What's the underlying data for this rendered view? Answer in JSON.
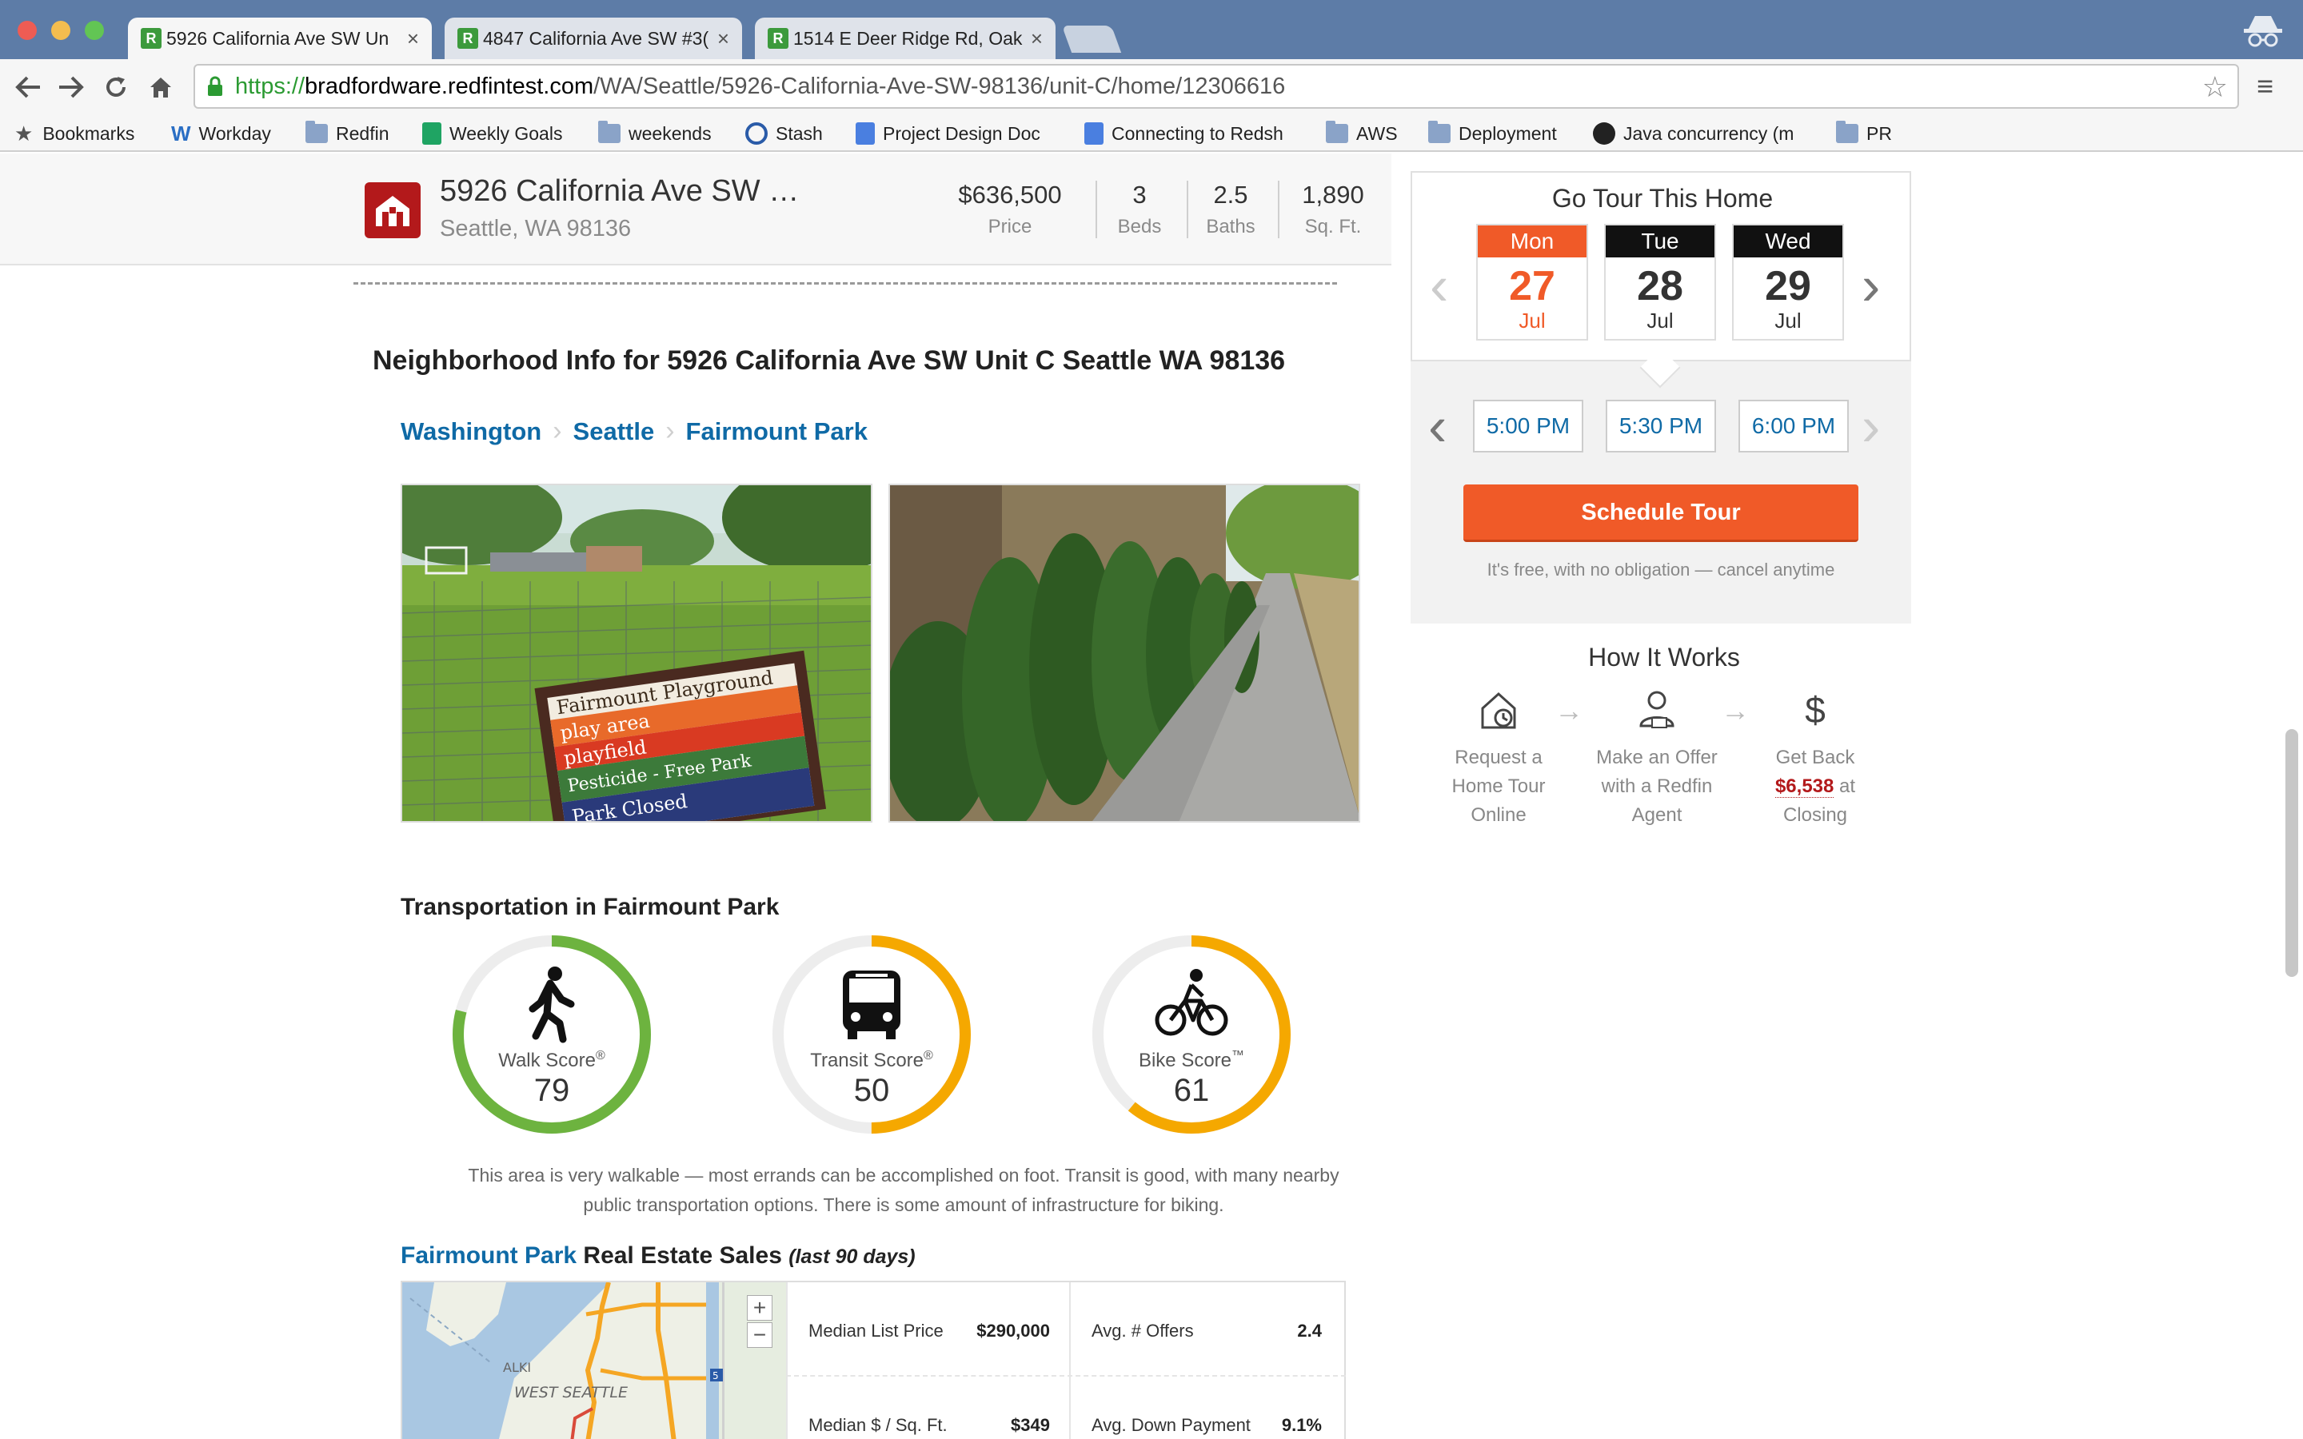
{
  "browser": {
    "tabs": [
      {
        "title": "5926 California Ave SW Un",
        "close": "×"
      },
      {
        "title": "4847 California Ave SW #3(",
        "close": "×"
      },
      {
        "title": "1514 E Deer Ridge Rd, Oak",
        "close": "×"
      }
    ],
    "favicon_letter": "R",
    "url": {
      "scheme": "https://",
      "host": "bradfordware.redfintest.com",
      "path": "/WA/Seattle/5926-California-Ave-SW-98136/unit-C/home/12306616"
    },
    "bookmarks": [
      {
        "label": "Bookmarks",
        "icon": "star-icon"
      },
      {
        "label": "Workday",
        "icon": "workday-icon"
      },
      {
        "label": "Redfin",
        "icon": "folder-icon"
      },
      {
        "label": "Weekly Goals",
        "icon": "sheets-icon"
      },
      {
        "label": "weekends",
        "icon": "folder-icon"
      },
      {
        "label": "Stash",
        "icon": "stash-icon"
      },
      {
        "label": "Project Design Doc",
        "icon": "docs-icon"
      },
      {
        "label": "Connecting to Redsh",
        "icon": "docs-icon"
      },
      {
        "label": "AWS",
        "icon": "folder-icon"
      },
      {
        "label": "Deployment",
        "icon": "folder-icon"
      },
      {
        "label": "Java concurrency (m",
        "icon": "github-icon"
      },
      {
        "label": "PR",
        "icon": "folder-icon"
      }
    ]
  },
  "listing": {
    "address_line1": "5926 California Ave SW …",
    "address_line2": "Seattle, WA 98136",
    "stats": [
      {
        "value": "$636,500",
        "label": "Price"
      },
      {
        "value": "3",
        "label": "Beds"
      },
      {
        "value": "2.5",
        "label": "Baths"
      },
      {
        "value": "1,890",
        "label": "Sq. Ft."
      }
    ]
  },
  "neighborhood": {
    "heading": "Neighborhood Info for 5926 California Ave SW Unit C Seattle WA 98136",
    "breadcrumbs": [
      "Washington",
      "Seattle",
      "Fairmount Park"
    ],
    "sign_lines": [
      "Fairmount Playground",
      "play area",
      "playfield",
      "Pesticide - Free Park",
      "Park Closed"
    ]
  },
  "transportation": {
    "heading": "Transportation in Fairmount Park",
    "scores": [
      {
        "label": "Walk Score",
        "mark": "®",
        "value": 79,
        "color": "#6db33f",
        "icon": "walker-icon"
      },
      {
        "label": "Transit Score",
        "mark": "®",
        "value": 50,
        "color": "#f5a800",
        "icon": "bus-icon"
      },
      {
        "label": "Bike Score",
        "mark": "™",
        "value": 61,
        "color": "#f5a800",
        "icon": "bicycle-icon"
      }
    ],
    "description": "This area is very walkable — most errands can be accomplished on foot. Transit is good, with many nearby public transportation options. There is some amount of infrastructure for biking."
  },
  "sales": {
    "heading_link": "Fairmount Park",
    "heading_rest": " Real Estate Sales ",
    "heading_days": "(last 90 days)",
    "map_labels": [
      "ALKI",
      "WEST SEATTLE",
      "5"
    ],
    "zoom_in": "+",
    "zoom_out": "−",
    "rows": [
      [
        {
          "label": "Median List Price",
          "value": "$290,000"
        },
        {
          "label": "Avg. # Offers",
          "value": "2.4"
        }
      ],
      [
        {
          "label": "Median $ / Sq. Ft.",
          "value": "$349"
        },
        {
          "label": "Avg. Down Payment",
          "value": "9.1%"
        }
      ]
    ]
  },
  "tour": {
    "title": "Go Tour This Home",
    "days": [
      {
        "name": "Mon",
        "date": "27",
        "month": "Jul",
        "selected": true
      },
      {
        "name": "Tue",
        "date": "28",
        "month": "Jul",
        "selected": false
      },
      {
        "name": "Wed",
        "date": "29",
        "month": "Jul",
        "selected": false
      }
    ],
    "times": [
      "5:00 PM",
      "5:30 PM",
      "6:00 PM"
    ],
    "schedule_label": "Schedule Tour",
    "free_note": "It's free, with no obligation — cancel anytime"
  },
  "how_it_works": {
    "title": "How It Works",
    "steps": [
      {
        "lines": [
          "Request a",
          "Home Tour",
          "Online"
        ]
      },
      {
        "lines": [
          "Make an Offer",
          "with a Redfin",
          "Agent"
        ]
      },
      {
        "lines": [
          "Get Back",
          "$6,538",
          "at",
          "Closing"
        ]
      }
    ]
  },
  "colors": {
    "accent": "#f05a28",
    "link": "#0f6aa6",
    "brand": "#b3191b",
    "walk": "#6db33f",
    "transit_bike": "#f5a800"
  }
}
